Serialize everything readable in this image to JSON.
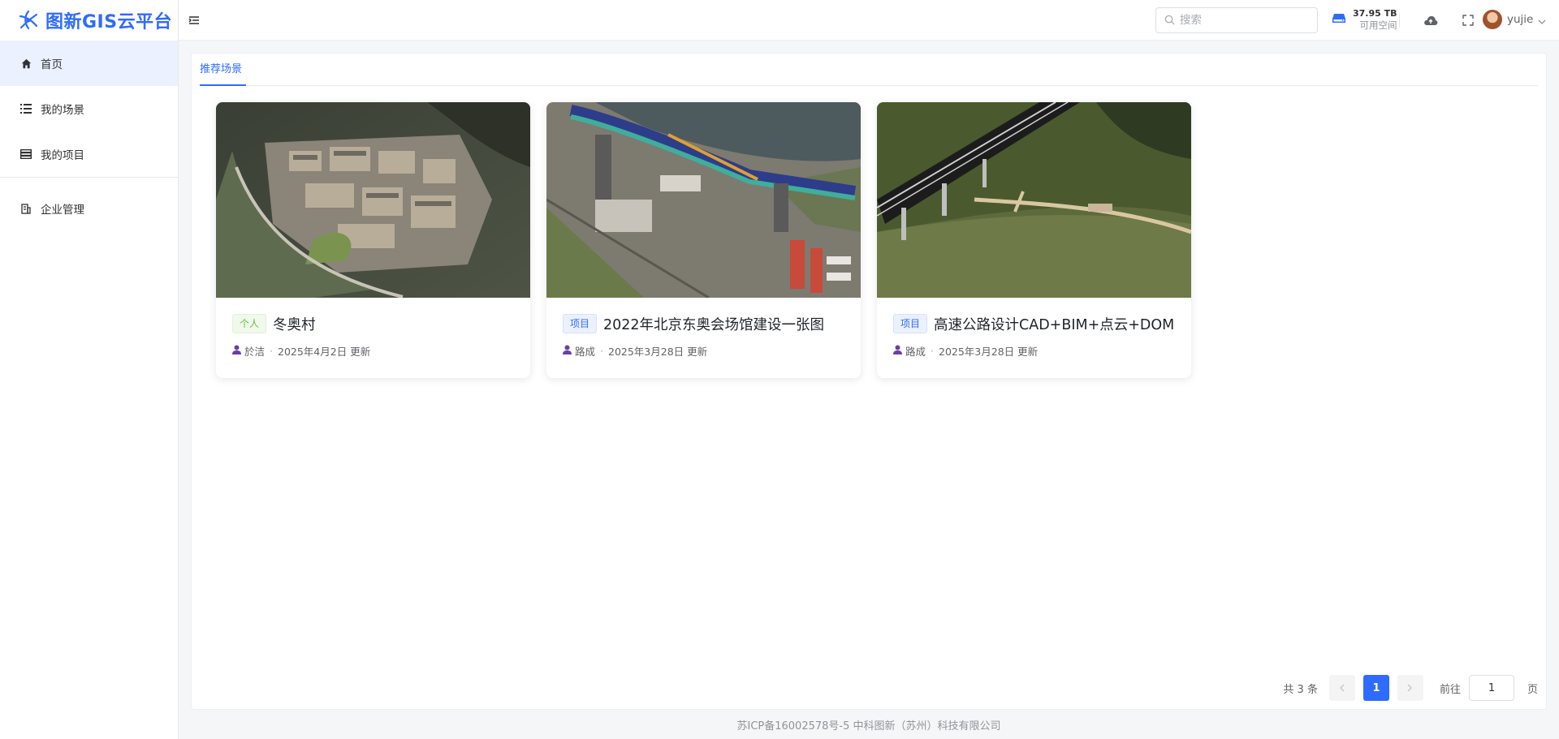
{
  "app": {
    "logo_text": "图新GIS云平台",
    "brand_color": "#2f6bff"
  },
  "sidebar": {
    "items": [
      {
        "label": "首页",
        "icon": "home-icon",
        "active": true
      },
      {
        "label": "我的场景",
        "icon": "list-icon"
      },
      {
        "label": "我的项目",
        "icon": "stack-icon"
      },
      {
        "label": "企业管理",
        "icon": "building-icon"
      }
    ]
  },
  "header": {
    "search_placeholder": "搜索",
    "storage_value": "37.95 TB",
    "storage_label": "可用空间",
    "username": "yujie"
  },
  "main": {
    "tab_label": "推荐场景",
    "cards": [
      {
        "tag": "个人",
        "tag_type": "personal",
        "title": "冬奥村",
        "author": "於洁",
        "updated": "2025年4月2日 更新"
      },
      {
        "tag": "项目",
        "tag_type": "project",
        "title": "2022年北京东奥会场馆建设一张图",
        "author": "路成",
        "updated": "2025年3月28日 更新"
      },
      {
        "tag": "项目",
        "tag_type": "project",
        "title": "高速公路设计CAD+BIM+点云+DOM",
        "author": "路成",
        "updated": "2025年3月28日 更新"
      }
    ],
    "meta_separator": "·"
  },
  "pagination": {
    "total": "共 3 条",
    "current_page": "1",
    "goto_label": "前往",
    "goto_value": "1",
    "page_suffix": "页"
  },
  "footer": {
    "text": "苏ICP备16002578号-5 中科图新（苏州）科技有限公司"
  }
}
